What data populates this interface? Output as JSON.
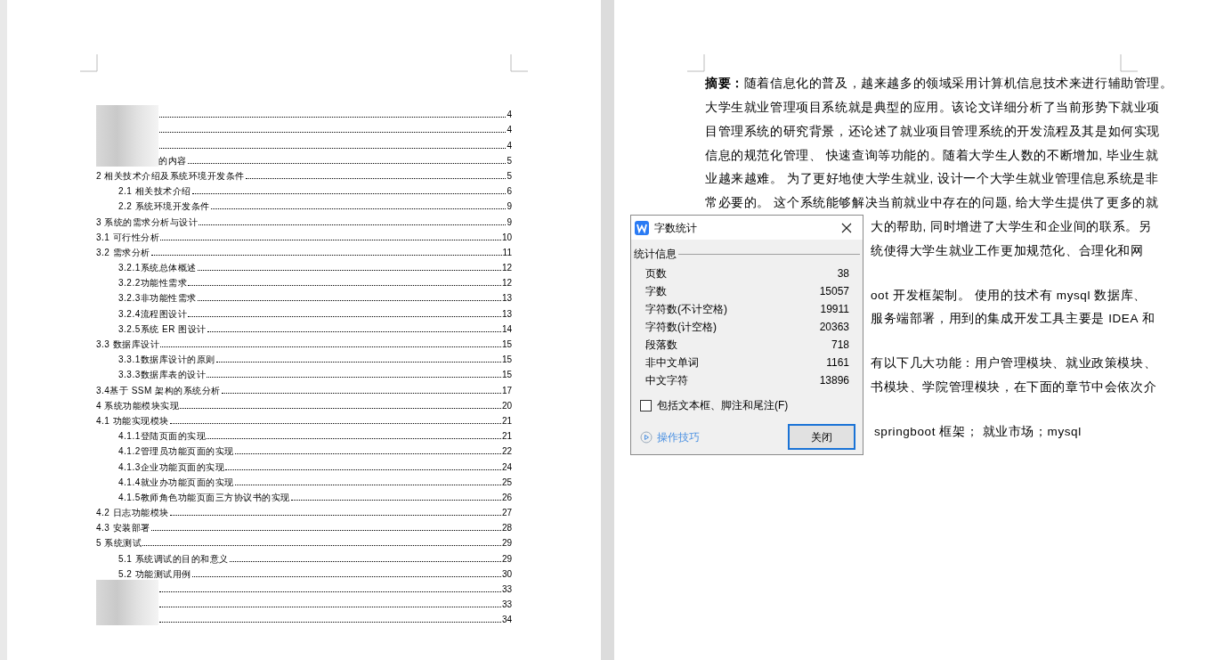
{
  "toc": [
    {
      "page": "4",
      "blurred": true
    },
    {
      "page": "4",
      "blurred": true
    },
    {
      "page": "4",
      "blurred": true
    },
    {
      "title": "的内容",
      "page": "5",
      "blurred": true
    },
    {
      "title": "2 相关技术介绍及系统环境开发条件",
      "page": "5",
      "children": [
        {
          "title": "2.1 相关技术介绍",
          "page": "6"
        },
        {
          "title": "2.2 系统环境开发条件",
          "page": "9"
        }
      ]
    },
    {
      "title": "3 系统的需求分析与设计",
      "page": "9"
    },
    {
      "title": "3.1 可行性分析",
      "page": "10"
    },
    {
      "title": "3.2 需求分析",
      "page": "11",
      "children": [
        {
          "title": "3.2.1系统总体概述",
          "page": "12"
        },
        {
          "title": "3.2.2功能性需求",
          "page": "12"
        },
        {
          "title": "3.2.3非功能性需求",
          "page": "13"
        },
        {
          "title": "3.2.4流程图设计",
          "page": "13"
        },
        {
          "title": "3.2.5系统 ER 图设计",
          "page": "14"
        }
      ]
    },
    {
      "title": "3.3 数据库设计",
      "page": "15",
      "children": [
        {
          "title": "3.3.1数据库设计的原则",
          "page": "15"
        },
        {
          "title": "3.3.3数据库表的设计",
          "page": "15"
        }
      ]
    },
    {
      "title": "3.4基于 SSM 架构的系统分析",
      "page": "17"
    },
    {
      "title": "4 系统功能模块实现",
      "page": "20"
    },
    {
      "title": "4.1 功能实现模块",
      "page": "21",
      "children": [
        {
          "title": "4.1.1登陆页面的实现",
          "page": "21"
        },
        {
          "title": "4.1.2管理员功能页面的实现",
          "page": "22"
        },
        {
          "title": "4.1.3企业功能页面的实现",
          "page": "24"
        },
        {
          "title": "4.1.4就业办功能页面的实现",
          "page": "25"
        },
        {
          "title": "4.1.5教师角色功能页面三方协议书的实现",
          "page": "26"
        }
      ]
    },
    {
      "title": "4.2 日志功能模块",
      "page": "27"
    },
    {
      "title": "4.3 安装部署",
      "page": "28"
    },
    {
      "title": "5 系统测试",
      "page": "29",
      "children": [
        {
          "title": "5.1 系统调试的目的和意义",
          "page": "29"
        },
        {
          "title": "5.2 功能测试用例",
          "page": "30"
        }
      ]
    },
    {
      "page": "33",
      "blurred": true
    },
    {
      "page": "33",
      "blurred": true
    },
    {
      "page": "34",
      "blurred": true
    }
  ],
  "abstract": {
    "label": "摘要：",
    "paragraphs": [
      {
        "lines": [
          {
            "text": "随着信息化的普及，越来越多的领域采用计算机信息技术来进行辅助管理。",
            "partial": false
          },
          {
            "text": "大学生就业管理项目系统就是典型的应用。该论文详细分析了当前形势下就业项",
            "partial": false
          },
          {
            "text": "目管理系统的研究背景，还论述了就业项目管理系统的开发流程及其是如何实现",
            "partial": false
          },
          {
            "text": "信息的规范化管理、 快速查询等功能的。随着大学生人数的不断增加, 毕业生就",
            "partial": false
          },
          {
            "text": "业越来越难。 为了更好地使大学生就业, 设计一个大学生就业管理信息系统是非",
            "partial": false
          },
          {
            "text": "常必要的。 这个系统能够解决当前就业中存在的问题, 给大学生提供了更多的就",
            "partial": false
          },
          {
            "text": "大的帮助, 同时增进了大学生和企业间的联系。另",
            "partial": true
          },
          {
            "text": "统使得大学生就业工作更加规范化、合理化和网",
            "partial": true
          }
        ]
      },
      {
        "lines": [
          {
            "text": "oot 开发框架制。 使用的技术有 mysql 数据库、",
            "partial": true
          },
          {
            "text": "服务端部署，用到的集成开发工具主要是 IDEA 和",
            "partial": true
          }
        ]
      },
      {
        "lines": [
          {
            "text": "有以下几大功能：用户管理模块、就业政策模块、",
            "partial": true
          },
          {
            "text": "书模块、学院管理模块，在下面的章节中会依次介",
            "partial": true
          }
        ]
      },
      {
        "lines": [
          {
            "text": "springboot 框架； 就业市场；mysql",
            "partial": true
          }
        ]
      }
    ]
  },
  "dialog": {
    "title": "字数统计",
    "section": "统计信息",
    "stats": [
      {
        "label": "页数",
        "value": "38"
      },
      {
        "label": "字数",
        "value": "15057"
      },
      {
        "label": "字符数(不计空格)",
        "value": "19911"
      },
      {
        "label": "字符数(计空格)",
        "value": "20363"
      },
      {
        "label": "段落数",
        "value": "718"
      },
      {
        "label": "非中文单词",
        "value": "1161"
      },
      {
        "label": "中文字符",
        "value": "13896"
      }
    ],
    "checkbox": {
      "label": "包括文本框、脚注和尾注(F)",
      "checked": false
    },
    "tips_link": "操作技巧",
    "close_button": "关闭"
  }
}
